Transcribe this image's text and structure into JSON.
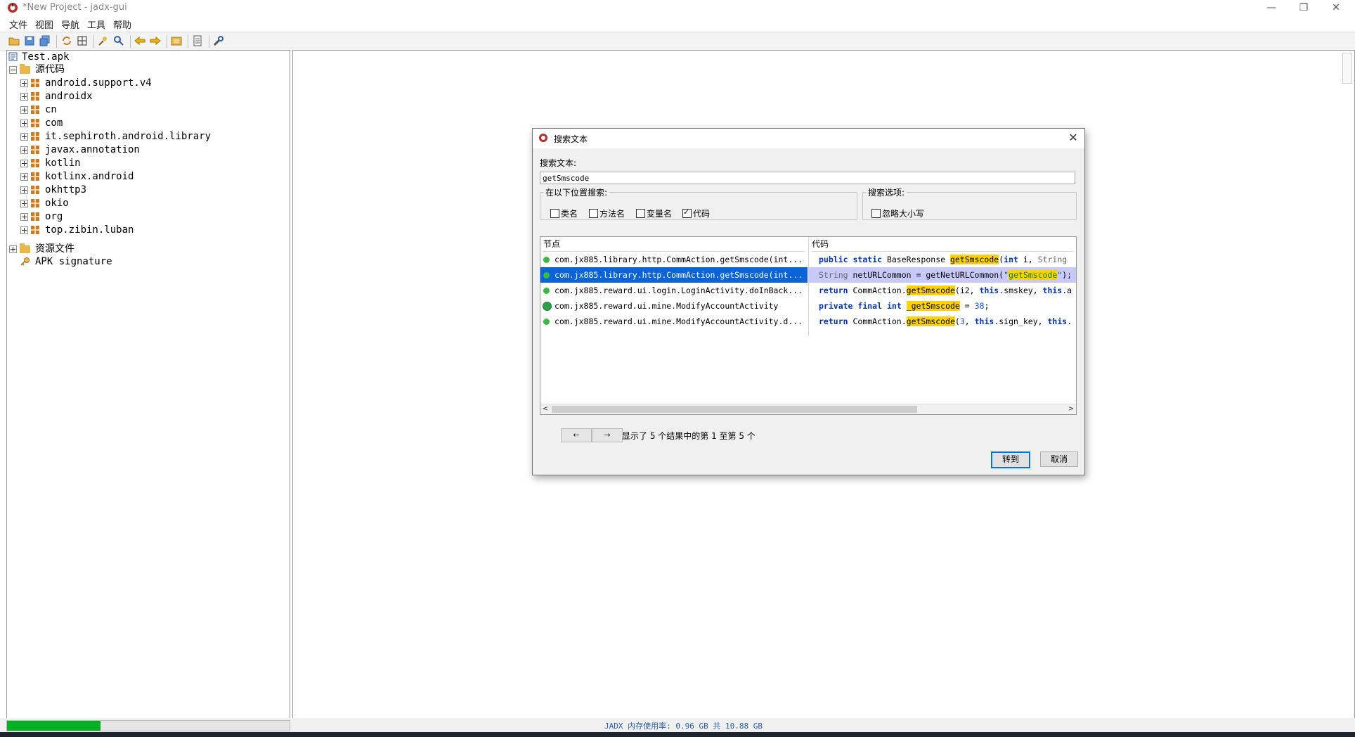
{
  "window": {
    "title": "*New Project - jadx-gui",
    "minimize": "—",
    "restore": "❐",
    "close": "✕"
  },
  "menu": [
    "文件",
    "视图",
    "导航",
    "工具",
    "帮助"
  ],
  "toolbar_icons": [
    "open-icon",
    "save-icon",
    "save-all-icon",
    "sync-icon",
    "deobfuscate-icon",
    "search-icon",
    "find-icon",
    "back-icon",
    "forward-icon",
    "log-icon",
    "preferences-icon",
    "settings-icon"
  ],
  "tree": {
    "root": "Test.apk",
    "sources_label": "源代码",
    "packages": [
      "android.support.v4",
      "androidx",
      "cn",
      "com",
      "it.sephiroth.android.library",
      "javax.annotation",
      "kotlin",
      "kotlinx.android",
      "okhttp3",
      "okio",
      "org",
      "top.zibin.luban"
    ],
    "resources_label": "资源文件",
    "signature_label": "APK signature"
  },
  "status": {
    "memory_label": "JADX 内存使用率: 0.96 GB 共 10.88 GB",
    "progress_fraction": 0.33,
    "progress_color": "#06b025"
  },
  "dialog": {
    "title": "搜索文本",
    "search_label": "搜索文本:",
    "search_value": "getSmscode",
    "search_in_legend": "在以下位置搜索:",
    "search_in": [
      {
        "label": "类名",
        "checked": false
      },
      {
        "label": "方法名",
        "checked": false
      },
      {
        "label": "变量名",
        "checked": false
      },
      {
        "label": "代码",
        "checked": true
      }
    ],
    "options_legend": "搜索选项:",
    "options": [
      {
        "label": "忽略大小写",
        "checked": false
      }
    ],
    "columns": {
      "node": "节点",
      "code": "代码"
    },
    "results": [
      {
        "node": "com.jx885.library.http.CommAction.getSmscode(int...",
        "selected": false,
        "icon": "method"
      },
      {
        "node": "com.jx885.library.http.CommAction.getSmscode(int...",
        "selected": true,
        "icon": "method"
      },
      {
        "node": "com.jx885.reward.ui.login.LoginActivity.doInBack...",
        "selected": false,
        "icon": "method"
      },
      {
        "node": "com.jx885.reward.ui.mine.ModifyAccountActivity",
        "selected": false,
        "icon": "class"
      },
      {
        "node": "com.jx885.reward.ui.mine.ModifyAccountActivity.d...",
        "selected": false,
        "icon": "method"
      }
    ],
    "prev_label": "←",
    "next_label": "→",
    "result_count": "显示了 5 个结果中的第 1 至第 5 个",
    "goto_label": "转到",
    "cancel_label": "取消"
  }
}
